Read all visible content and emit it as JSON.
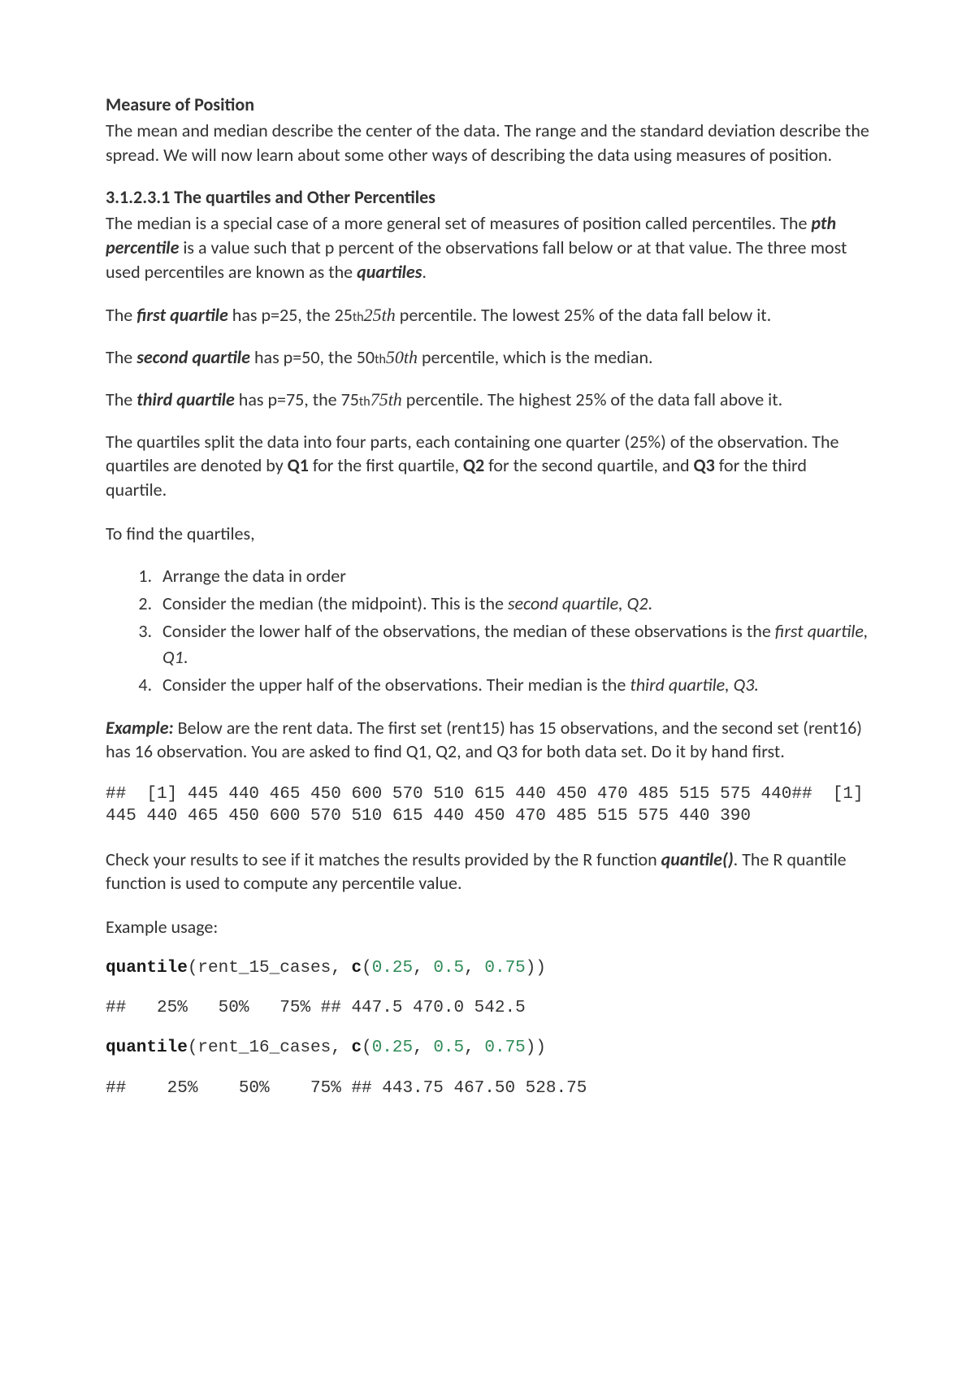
{
  "heading": "Measure of Position",
  "intro": "The mean and median describe the center of the data. The range and the standard deviation describe the spread. We will now learn about some other ways of describing the data using measures of position.",
  "sub_heading": "3.1.2.3.1 The quartiles and Other Percentiles",
  "p_percentiles_a": "The median is a special case of a more general set of measures of position called percentiles. The ",
  "pth_percentile": "pth percentile",
  "p_percentiles_b": " is a value such that p percent of the observations fall below or at that value. The three most used percentiles are known as the ",
  "quartiles_word": "quartiles",
  "period": ".",
  "q1_a": "The ",
  "q1_label": "first quartile",
  "q1_b": " has p=25, the ",
  "q1_num": "25",
  "th_small": "th",
  "q1_math": "25th",
  "q1_c": " percentile. The lowest 25% of the data fall below it.",
  "q2_a": "The ",
  "q2_label": "second quartile",
  "q2_b": " has p=50, the ",
  "q2_num": "50",
  "q2_math": "50th",
  "q2_c": " percentile, which is the median.",
  "q3_a": "The ",
  "q3_label": "third quartile",
  "q3_b": " has p=75, the ",
  "q3_num": "75",
  "q3_math": "75th",
  "q3_c": " percentile. The highest 25% of the data fall above it.",
  "split_a": "The quartiles split the data into four parts, each containing one quarter (25%) of the observation. The quartiles are denoted by ",
  "Q1": "Q1",
  "split_b": " for the first quartile, ",
  "Q2": "Q2",
  "split_c": " for the second quartile, and ",
  "Q3": "Q3",
  "split_d": " for the third quartile.",
  "to_find": "To find the quartiles,",
  "steps": {
    "s1": "Arrange the data in order",
    "s2_a": "Consider the median (the midpoint). This is the ",
    "s2_i": "second quartile, Q2",
    "s3_a": "Consider the lower half of the observations, the median of these observations is the ",
    "s3_i": "first quartile, Q1",
    "s4_a": "Consider the upper half of the observations. Their median is the ",
    "s4_i": "third quartile, Q3."
  },
  "example_label": "Example:",
  "example_text": " Below are the rent data. The first set (rent15) has 15 observations, and the second set (rent16) has 16 observation. You are asked to find Q1, Q2, and Q3 for both data set. Do it by hand first.",
  "data_block": "##  [1] 445 440 465 450 600 570 510 615 440 450 470 485 515 575 440##  [1] 445 440 465 450 600 570 510 615 440 450 470 485 515 575 440 390",
  "check_a": "Check your results to see if it matches the results provided by the R function ",
  "quantile_fn": "quantile()",
  "check_b": ". The R quantile function is used to compute any percentile value.",
  "usage": "Example usage:",
  "code1": {
    "fn": "quantile",
    "open": "(rent_15_cases, ",
    "c": "c",
    "popen": "(",
    "a": "0.25",
    "comma": ", ",
    "b": "0.5",
    "d": "0.75",
    "close": "))"
  },
  "out1": "##   25%   50%   75% ## 447.5 470.0 542.5",
  "code2": {
    "fn": "quantile",
    "open": "(rent_16_cases, ",
    "c": "c",
    "popen": "(",
    "a": "0.25",
    "comma": ", ",
    "b": "0.5",
    "d": "0.75",
    "close": "))"
  },
  "out2": "##    25%    50%    75% ## 443.75 467.50 528.75"
}
